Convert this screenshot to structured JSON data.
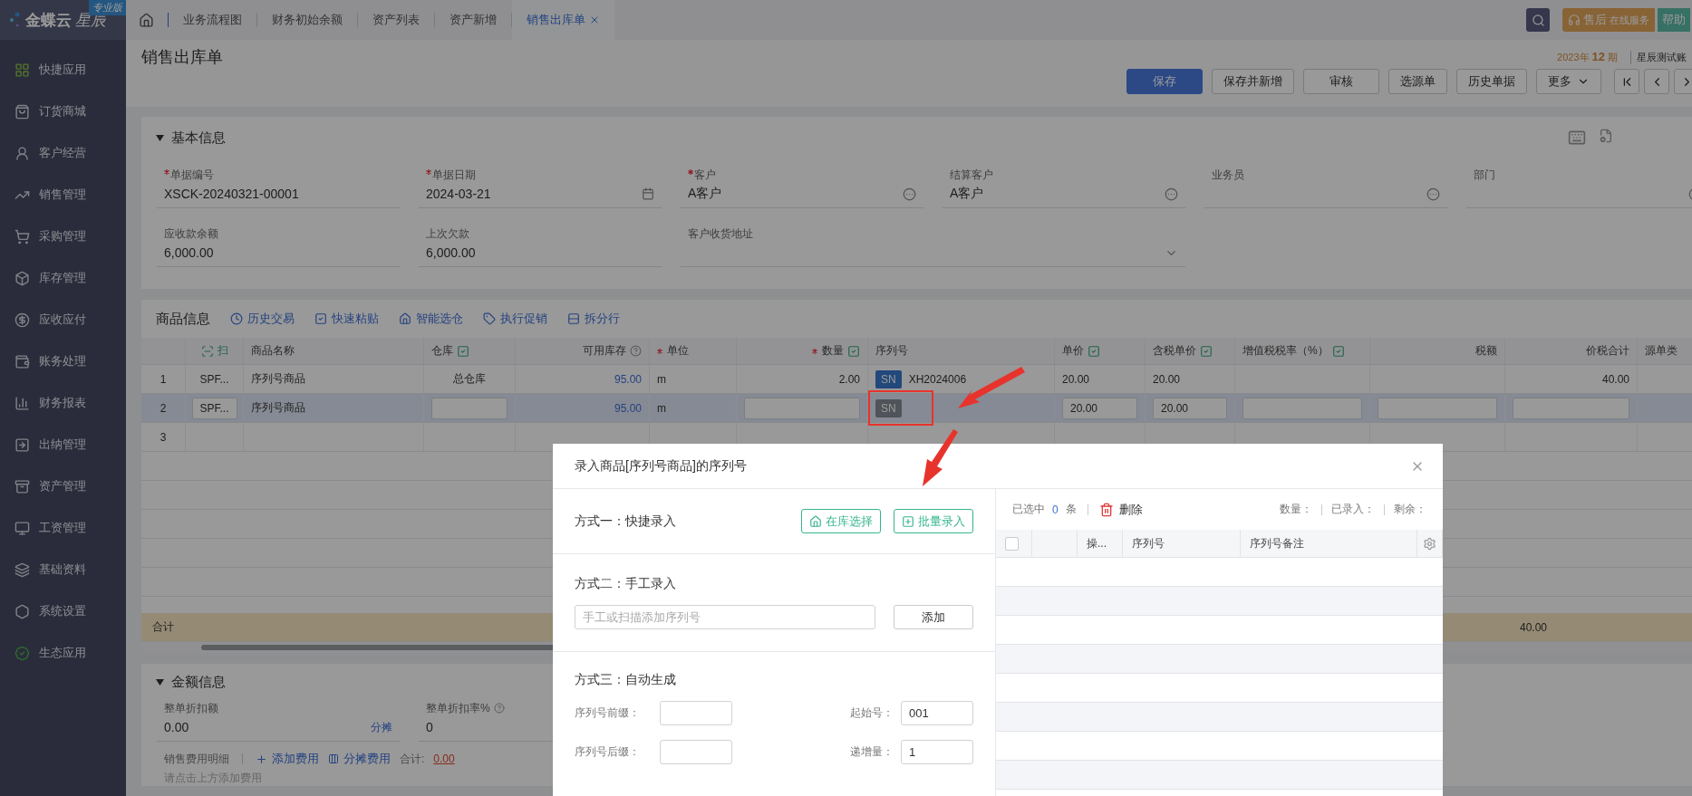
{
  "sidebar": {
    "logo": "金蝶云",
    "logo_script": "星辰",
    "edition": "专业版",
    "items": [
      {
        "label": "快捷应用"
      },
      {
        "label": "订货商城"
      },
      {
        "label": "客户经营"
      },
      {
        "label": "销售管理"
      },
      {
        "label": "采购管理"
      },
      {
        "label": "库存管理"
      },
      {
        "label": "应收应付"
      },
      {
        "label": "账务处理"
      },
      {
        "label": "财务报表"
      },
      {
        "label": "出纳管理"
      },
      {
        "label": "资产管理"
      },
      {
        "label": "工资管理"
      },
      {
        "label": "基础资料"
      },
      {
        "label": "系统设置"
      },
      {
        "label": "生态应用"
      }
    ]
  },
  "tabs": [
    {
      "label": "业务流程图",
      "selected": false,
      "closable": false
    },
    {
      "label": "财务初始余额",
      "selected": false,
      "closable": false
    },
    {
      "label": "资产列表",
      "selected": false,
      "closable": false
    },
    {
      "label": "资产新增",
      "selected": false,
      "closable": false
    },
    {
      "label": "销售出库单",
      "selected": true,
      "closable": true
    }
  ],
  "top_bar": {
    "service": "售后",
    "service_note": "在线服务",
    "help": "帮助"
  },
  "page": {
    "title": "销售出库单",
    "period_year": "2023年",
    "period_number": "12",
    "period_unit": "期",
    "account": "星辰测试账"
  },
  "toolbar": [
    {
      "label": "保存",
      "kind": "primary"
    },
    {
      "label": "保存并新增",
      "kind": "default"
    },
    {
      "label": "审核",
      "kind": "default"
    },
    {
      "label": "选源单",
      "kind": "default"
    },
    {
      "label": "历史单据",
      "kind": "default"
    },
    {
      "label": "更多",
      "kind": "dropdown"
    }
  ],
  "basic_info": {
    "title": "基本信息",
    "expanded": true,
    "fields": [
      {
        "label": "单据编号",
        "required": true,
        "kind": "text",
        "value": "XSCK-20240321-00001"
      },
      {
        "label": "单据日期",
        "required": true,
        "kind": "date",
        "value": "2024-03-21"
      },
      {
        "label": "客户",
        "required": true,
        "kind": "lookup",
        "value": "A客户"
      },
      {
        "label": "结算客户",
        "required": false,
        "kind": "lookup",
        "value": "A客户"
      },
      {
        "label": "业务员",
        "required": false,
        "kind": "lookup"
      },
      {
        "label": "部门",
        "required": false,
        "kind": "lookup"
      },
      {
        "label": "应收款余额",
        "required": false,
        "kind": "text",
        "value": "6,000.00"
      },
      {
        "label": "上次欠款",
        "required": false,
        "kind": "text",
        "value": "6,000.00"
      },
      {
        "label": "客户收货地址",
        "required": false,
        "kind": "select"
      }
    ]
  },
  "goods": {
    "title": "商品信息",
    "actions": [
      {
        "label": "历史交易"
      },
      {
        "label": "快速粘贴"
      },
      {
        "label": "智能选仓"
      },
      {
        "label": "执行促销"
      },
      {
        "label": "拆分行"
      }
    ],
    "columns": [
      {
        "kind": "index"
      },
      {
        "kind": "scan",
        "label": "扫"
      },
      {
        "kind": "plain",
        "label": "商品名称",
        "required": false
      },
      {
        "kind": "batch",
        "label": "仓库",
        "required": false
      },
      {
        "kind": "help",
        "label": "可用库存",
        "required": false
      },
      {
        "kind": "plain",
        "label": "单位",
        "required": true
      },
      {
        "kind": "batch",
        "label": "数量",
        "required": true
      },
      {
        "kind": "plain",
        "label": "序列号",
        "required": false
      },
      {
        "kind": "batch",
        "label": "单价",
        "required": false
      },
      {
        "kind": "batch",
        "label": "含税单价",
        "required": false
      },
      {
        "kind": "batch",
        "label": "增值税税率（%）",
        "required": false
      },
      {
        "kind": "plain",
        "label": "税额",
        "required": false
      },
      {
        "kind": "plain",
        "label": "价税合计",
        "required": false
      },
      {
        "kind": "plain",
        "label": "源单类",
        "required": false
      }
    ],
    "rows": [
      {
        "selected": false,
        "cells": [
          {
            "kind": "number",
            "value": "1"
          },
          {
            "kind": "text",
            "value": "SPF..."
          },
          {
            "kind": "text",
            "value": "序列号商品"
          },
          {
            "kind": "text",
            "value": "总仓库"
          },
          {
            "kind": "link",
            "value": "95.00"
          },
          {
            "kind": "text",
            "value": "m"
          },
          {
            "kind": "text",
            "value": "2.00"
          },
          {
            "kind": "serial",
            "badge": "SN",
            "enabled": true,
            "value": "XH2024006"
          },
          {
            "kind": "text",
            "value": "20.00"
          },
          {
            "kind": "text",
            "value": "20.00"
          },
          {
            "kind": "text"
          },
          {
            "kind": "text"
          },
          {
            "kind": "text",
            "value": "40.00"
          },
          {
            "kind": "text"
          }
        ]
      },
      {
        "selected": true,
        "cells": [
          {
            "kind": "number",
            "value": "2"
          },
          {
            "kind": "input",
            "value": "SPF..."
          },
          {
            "kind": "text",
            "value": "序列号商品"
          },
          {
            "kind": "input"
          },
          {
            "kind": "link",
            "value": "95.00"
          },
          {
            "kind": "text",
            "value": "m"
          },
          {
            "kind": "input"
          },
          {
            "kind": "serial",
            "badge": "SN",
            "enabled": false
          },
          {
            "kind": "input",
            "value": "20.00"
          },
          {
            "kind": "input",
            "value": "20.00"
          },
          {
            "kind": "input"
          },
          {
            "kind": "input"
          },
          {
            "kind": "input"
          },
          {
            "kind": "text"
          }
        ]
      },
      {
        "selected": false,
        "cells": [
          {
            "kind": "number",
            "value": "3"
          },
          {
            "kind": "text"
          },
          {
            "kind": "text"
          },
          {
            "kind": "text"
          },
          {
            "kind": "text"
          },
          {
            "kind": "text"
          },
          {
            "kind": "text"
          },
          {
            "kind": "text"
          },
          {
            "kind": "text"
          },
          {
            "kind": "text"
          },
          {
            "kind": "text"
          },
          {
            "kind": "text"
          },
          {
            "kind": "text"
          },
          {
            "kind": "text"
          }
        ]
      }
    ],
    "total": {
      "label": "合计",
      "amount": "40.00"
    }
  },
  "amount_info": {
    "title": "金额信息",
    "expanded": true,
    "fields": [
      {
        "label": "整单折扣额",
        "value": "0.00",
        "action": "分摊",
        "help": false
      },
      {
        "label": "整单折扣率%",
        "value": "0",
        "help": true
      }
    ],
    "expense": {
      "label": "销售费用明细",
      "add": "添加费用",
      "allocate": "分摊费用",
      "total_label": "合计:",
      "total": "0.00",
      "placeholder": "请点击上方添加费用"
    }
  },
  "dialog": {
    "title": "录入商品[序列号商品]的序列号",
    "methods": [
      {
        "kind": "quick",
        "title": "方式一：快捷录入",
        "buttons": [
          "在库选择",
          "批量录入"
        ]
      },
      {
        "kind": "manual",
        "title": "方式二：手工录入",
        "placeholder": "手工或扫描添加序列号",
        "button": "添加"
      },
      {
        "kind": "auto",
        "title": "方式三：自动生成",
        "fields": [
          {
            "label": "序列号前缀："
          },
          {
            "label": "起始号：",
            "value": "001"
          },
          {
            "label": "序列号后缀："
          },
          {
            "label": "递增量：",
            "value": "1"
          }
        ]
      }
    ],
    "list": {
      "selected_label": "已选中",
      "selected_count": "0",
      "selected_unit": "条",
      "delete": "删除",
      "stats": [
        "数量：",
        "已录入：",
        "剩余："
      ],
      "select_all": false,
      "columns": [
        "操...",
        "序列号",
        "序列号备注"
      ]
    }
  }
}
